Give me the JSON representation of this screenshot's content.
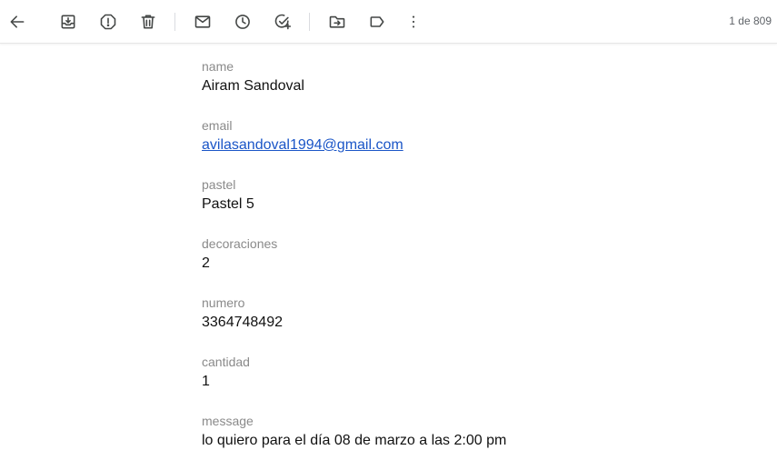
{
  "toolbar": {
    "buttons": [
      {
        "name": "back",
        "icon": "arrow-left-icon"
      },
      {
        "name": "archive",
        "icon": "archive-icon"
      },
      {
        "name": "report-spam",
        "icon": "spam-icon"
      },
      {
        "name": "delete",
        "icon": "trash-icon"
      },
      {
        "name": "mark-unread",
        "icon": "mail-icon"
      },
      {
        "name": "snooze",
        "icon": "clock-icon"
      },
      {
        "name": "add-to-tasks",
        "icon": "add-task-icon"
      },
      {
        "name": "move-to",
        "icon": "move-folder-icon"
      },
      {
        "name": "labels",
        "icon": "label-icon"
      },
      {
        "name": "more",
        "icon": "more-vertical-icon"
      }
    ],
    "counter": "1 de 809"
  },
  "fields": [
    {
      "label": "name",
      "value": "Airam Sandoval"
    },
    {
      "label": "email",
      "value": "avilasandoval1994@gmail.com"
    },
    {
      "label": "pastel",
      "value": "Pastel 5"
    },
    {
      "label": "decoraciones",
      "value": "2"
    },
    {
      "label": "numero",
      "value": "3364748492"
    },
    {
      "label": "cantidad",
      "value": "1"
    },
    {
      "label": "message",
      "value": "lo quiero para el día 08 de marzo a las 2:00 pm"
    }
  ],
  "colors": {
    "icon": "#444746",
    "label": "#8a8a8a",
    "link": "#1a55c7",
    "text": "#111111"
  }
}
